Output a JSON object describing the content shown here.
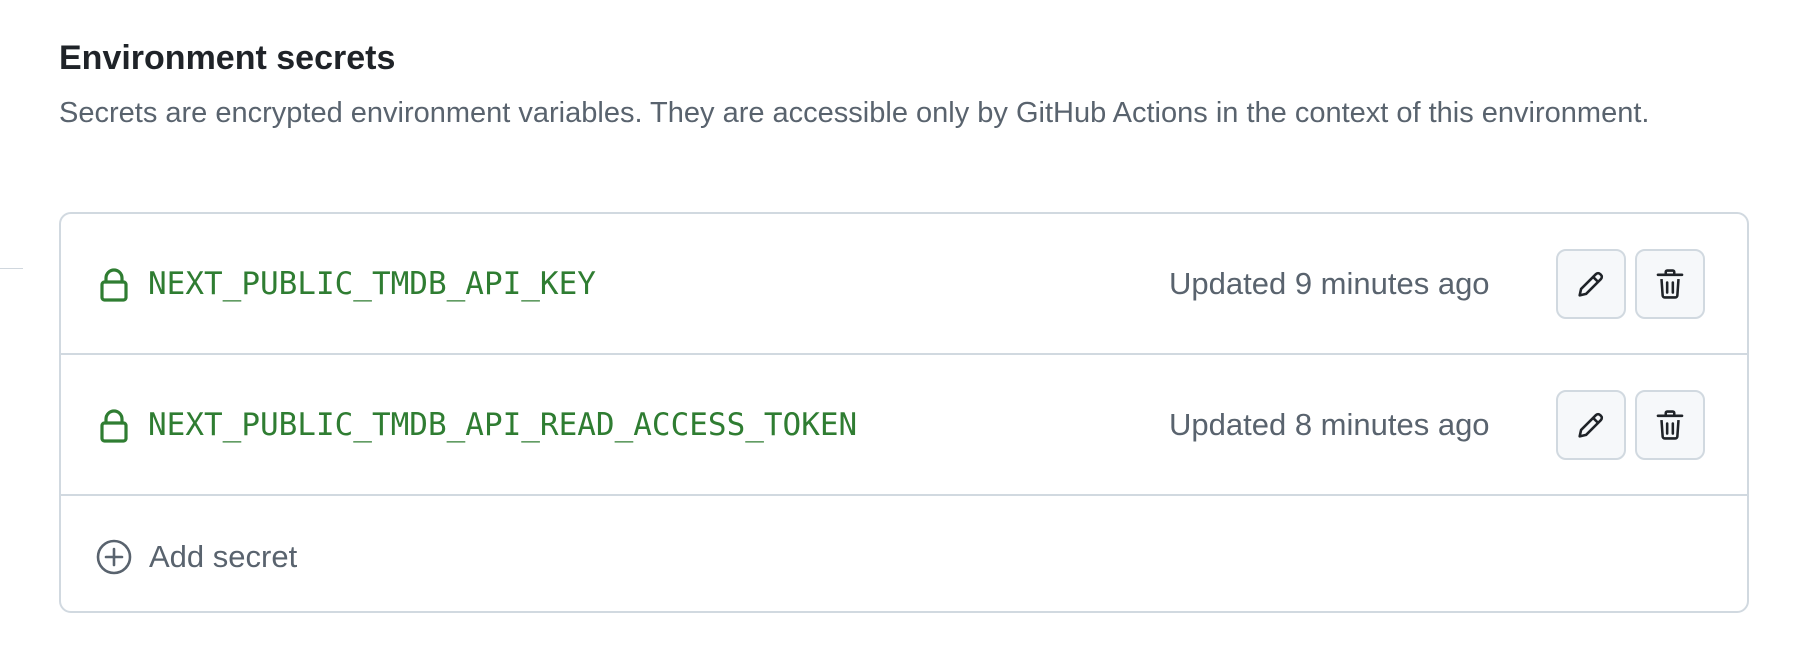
{
  "section": {
    "title": "Environment secrets",
    "description": "Secrets are encrypted environment variables. They are accessible only by GitHub Actions in the context of this environment."
  },
  "secrets": [
    {
      "name": "NEXT_PUBLIC_TMDB_API_KEY",
      "updated": "Updated 9 minutes ago",
      "icon": "lock-icon",
      "actions": [
        "edit",
        "delete"
      ]
    },
    {
      "name": "NEXT_PUBLIC_TMDB_API_READ_ACCESS_TOKEN",
      "updated": "Updated 8 minutes ago",
      "icon": "lock-icon",
      "actions": [
        "edit",
        "delete"
      ]
    }
  ],
  "add_secret": {
    "label": "Add secret",
    "icon": "plus-circle-icon"
  },
  "colors": {
    "secret_name": "#2f7d32",
    "muted_text": "#59636e",
    "border": "#d1d9e0",
    "button_bg": "#f6f8fa"
  }
}
